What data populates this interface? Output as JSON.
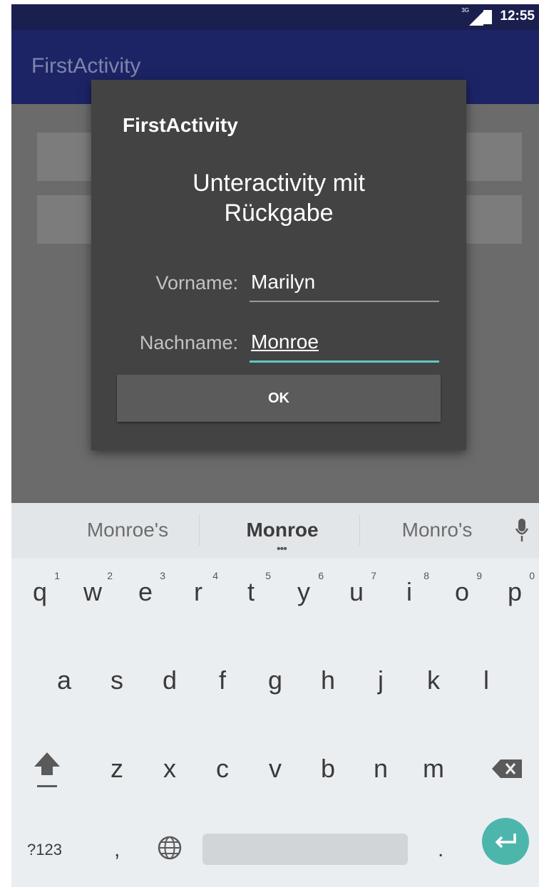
{
  "status_bar": {
    "network": "3G",
    "time": "12:55"
  },
  "app_bar": {
    "title": "FirstActivity"
  },
  "dialog": {
    "title": "FirstActivity",
    "heading_line1": "Unteractivity mit",
    "heading_line2": "Rückgabe",
    "first_name_label": "Vorname:",
    "first_name_value": "Marilyn",
    "last_name_label": "Nachname:",
    "last_name_value": "Monroe",
    "ok_label": "OK"
  },
  "keyboard": {
    "suggestions": [
      "Monroe's",
      "Monroe",
      "Monro's"
    ],
    "row1": [
      {
        "label": "q",
        "hint": "1"
      },
      {
        "label": "w",
        "hint": "2"
      },
      {
        "label": "e",
        "hint": "3"
      },
      {
        "label": "r",
        "hint": "4"
      },
      {
        "label": "t",
        "hint": "5"
      },
      {
        "label": "y",
        "hint": "6"
      },
      {
        "label": "u",
        "hint": "7"
      },
      {
        "label": "i",
        "hint": "8"
      },
      {
        "label": "o",
        "hint": "9"
      },
      {
        "label": "p",
        "hint": "0"
      }
    ],
    "row2": [
      "a",
      "s",
      "d",
      "f",
      "g",
      "h",
      "j",
      "k",
      "l"
    ],
    "row3": [
      "z",
      "x",
      "c",
      "v",
      "b",
      "n",
      "m"
    ],
    "symbols_label": "?123",
    "comma": ",",
    "period": ".",
    "icons": {
      "shift": "shift-arrow-icon",
      "backspace": "backspace-icon",
      "globe": "globe-icon",
      "enter": "enter-icon",
      "mic": "microphone-icon"
    },
    "colors": {
      "accent": "#4db6ac"
    }
  }
}
